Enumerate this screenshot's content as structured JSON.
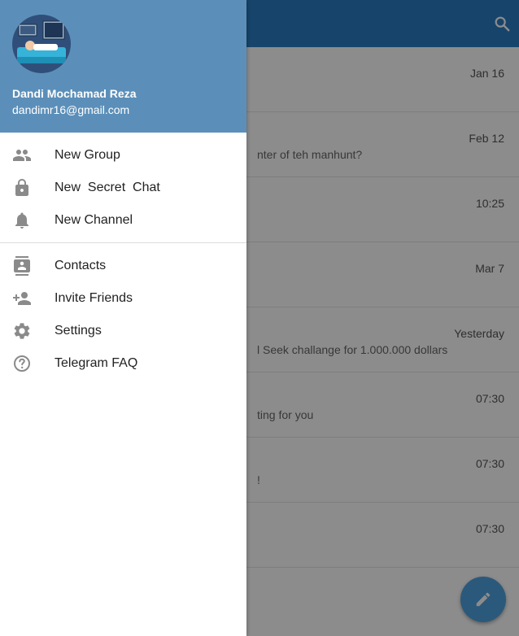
{
  "chat_list": {
    "rows": [
      {
        "time": "Jan 16",
        "preview": ""
      },
      {
        "time": "Feb 12",
        "preview": "nter of teh manhunt?"
      },
      {
        "time": "10:25",
        "preview": ""
      },
      {
        "time": "Mar 7",
        "preview": ""
      },
      {
        "time": "Yesterday",
        "preview": "l Seek challange for 1.000.000 dollars"
      },
      {
        "time": "07:30",
        "preview": "ting for you"
      },
      {
        "time": "07:30",
        "preview": "!"
      },
      {
        "time": "07:30",
        "preview": ""
      }
    ]
  },
  "drawer": {
    "user": {
      "name": "Dandi Mochamad Reza",
      "email": "dandimr16@gmail.com"
    },
    "primary_items": [
      {
        "label": "New Group",
        "icon": "group-icon"
      },
      {
        "label": "New  Secret  Chat",
        "icon": "lock-icon"
      },
      {
        "label": "New Channel",
        "icon": "bell-icon"
      }
    ],
    "secondary_items": [
      {
        "label": "Contacts",
        "icon": "contacts-icon"
      },
      {
        "label": "Invite Friends",
        "icon": "add-person-icon"
      },
      {
        "label": "Settings",
        "icon": "gear-icon"
      },
      {
        "label": "Telegram FAQ",
        "icon": "help-icon"
      }
    ]
  },
  "colors": {
    "app_bar": "#2b7cc4",
    "drawer_header": "#5b8fb9",
    "fab": "#4fa3e0",
    "icon": "#8a8a8a"
  }
}
